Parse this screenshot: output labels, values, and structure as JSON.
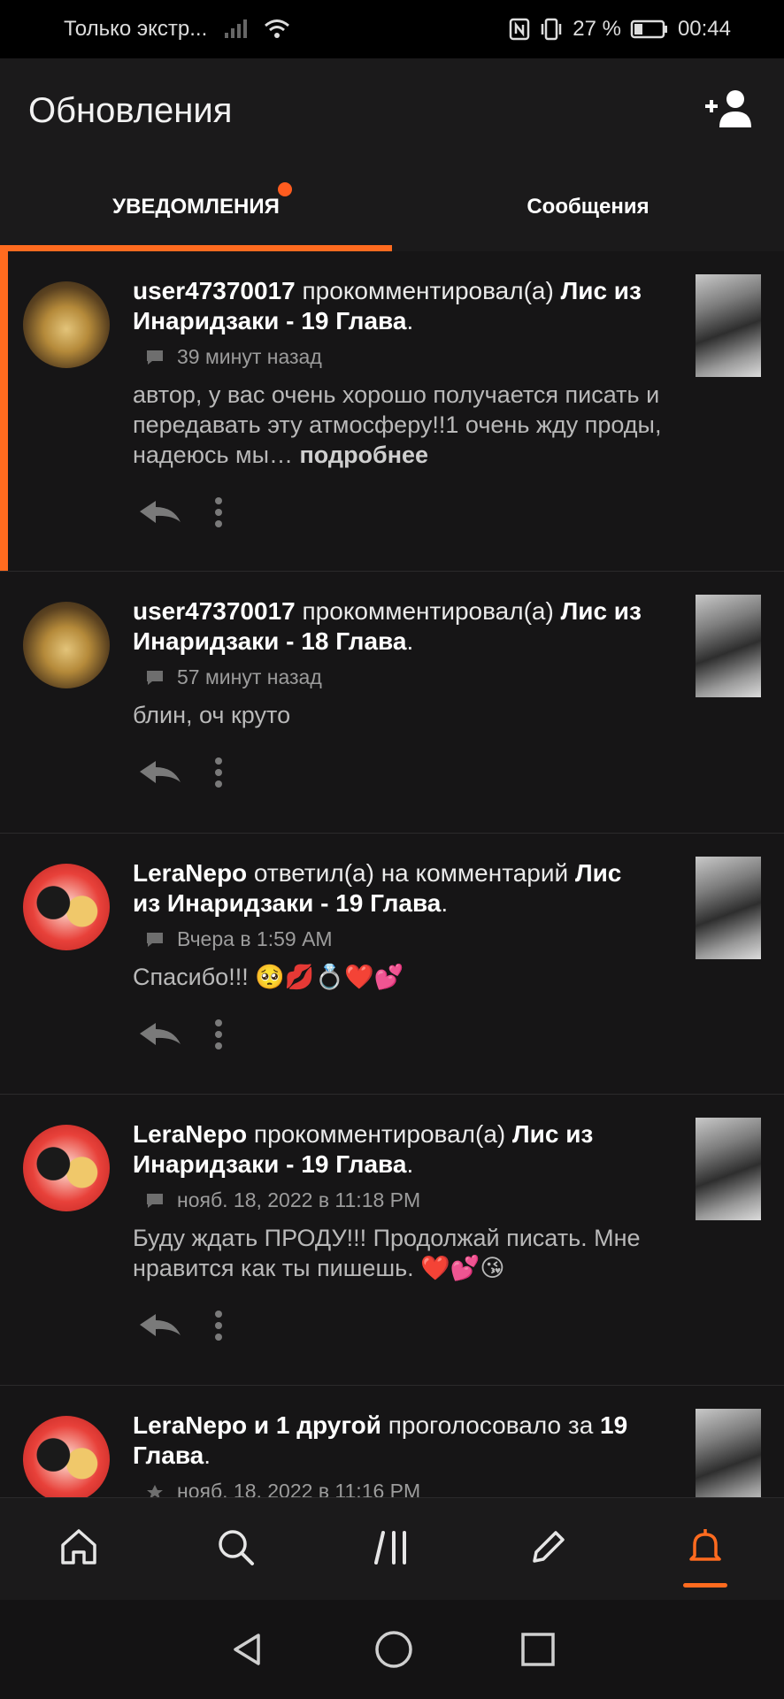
{
  "status_bar": {
    "carrier": "Только экстр...",
    "battery": "27 %",
    "time": "00:44"
  },
  "header": {
    "title": "Обновления",
    "add_user_icon": "add-user-icon"
  },
  "tabs": [
    {
      "label": "УВЕДОМЛЕНИЯ",
      "active": true,
      "has_dot": true
    },
    {
      "label": "Сообщения",
      "active": false,
      "has_dot": false
    }
  ],
  "notifications": [
    {
      "user": "user47370017",
      "action": " прокомментировал(а) ",
      "target": "Лис из Инаридзаки - 19 Глава",
      "suffix": ".",
      "time": "39 минут назад",
      "text": "автор, у вас очень хорошо получается писать и передавать эту атмосферу!!1 очень жду проды, надеюсь мы…",
      "more": " подробнее",
      "unread": true
    },
    {
      "user": "user47370017",
      "action": " прокомментировал(а) ",
      "target": "Лис из Инаридзаки - 18 Глава",
      "suffix": ".",
      "time": "57 минут назад",
      "text": "блин, оч круто",
      "unread": false
    },
    {
      "user": "LeraNepo",
      "action": " ответил(а) на комментарий ",
      "target": "Лис из Инаридзаки - 19 Глава",
      "suffix": ".",
      "time": "Вчера в 1:59 AM",
      "text": "Спасибо!!! 🥺💋💍❤️💕",
      "unread": false
    },
    {
      "user": "LeraNepo",
      "action": " прокомментировал(а) ",
      "target": "Лис из Инаридзаки - 19 Глава",
      "suffix": ".",
      "time": "нояб. 18, 2022 в 11:18 PM",
      "text": "Буду ждать ПРОДУ!!! Продолжай писать. Мне нравится как ты пишешь. ❤️💕😘",
      "unread": false
    },
    {
      "user": "LeraNepo и 1 другой",
      "action": " проголосовало за ",
      "target": "19 Глава",
      "suffix": ".",
      "time": "нояб. 18, 2022 в 11:16 PM",
      "text": "",
      "unread": false
    }
  ],
  "bottom_nav": [
    {
      "icon": "home-icon",
      "active": false
    },
    {
      "icon": "search-icon",
      "active": false
    },
    {
      "icon": "library-icon",
      "active": false
    },
    {
      "icon": "write-icon",
      "active": false
    },
    {
      "icon": "bell-icon",
      "active": true
    }
  ],
  "colors": {
    "accent": "#ff6b1f",
    "background": "#161516",
    "header": "#1b1a1b"
  }
}
